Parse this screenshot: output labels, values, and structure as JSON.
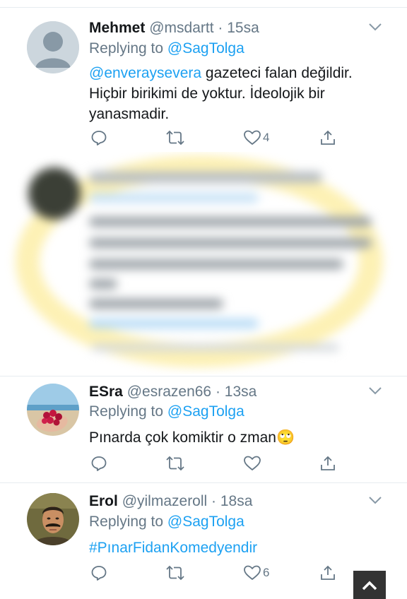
{
  "colors": {
    "link": "#1da1f2",
    "muted": "#657786",
    "text": "#14171a",
    "highlight": "#f7df5a"
  },
  "tweets": [
    {
      "name": "Mehmet",
      "handle": "@msdartt",
      "time": "· 15sa",
      "replying_prefix": "Replying to",
      "replying_to": "@SagTolga",
      "mention": "@enveraysevera",
      "lines": [
        " gazeteci falan değildir.",
        "Hiçbir birikimi de yoktur. İdeolojik bir",
        "yanasmadir."
      ],
      "like_count": "4",
      "avatar": "default-person-avatar"
    },
    {
      "name": "ESra",
      "handle": "@esrazen66",
      "time": "· 13sa",
      "replying_prefix": "Replying to",
      "replying_to": "@SagTolga",
      "text": "Pınarda çok komiktir o zman",
      "emoji": "🙄",
      "like_count": "",
      "avatar": "berries-photo-avatar"
    },
    {
      "name": "Erol",
      "handle": "@yilmazeroll",
      "time": "· 18sa",
      "replying_prefix": "Replying to",
      "replying_to": "@SagTolga",
      "hashtag": "#PınarFidanKomedyendir",
      "like_count": "6",
      "avatar": "man-with-mustache-avatar"
    }
  ],
  "icons": {
    "reply": "reply-icon",
    "retweet": "retweet-icon",
    "like": "heart-icon",
    "share": "share-icon",
    "more": "chevron-down-icon",
    "scroll": "chevron-up-icon"
  }
}
